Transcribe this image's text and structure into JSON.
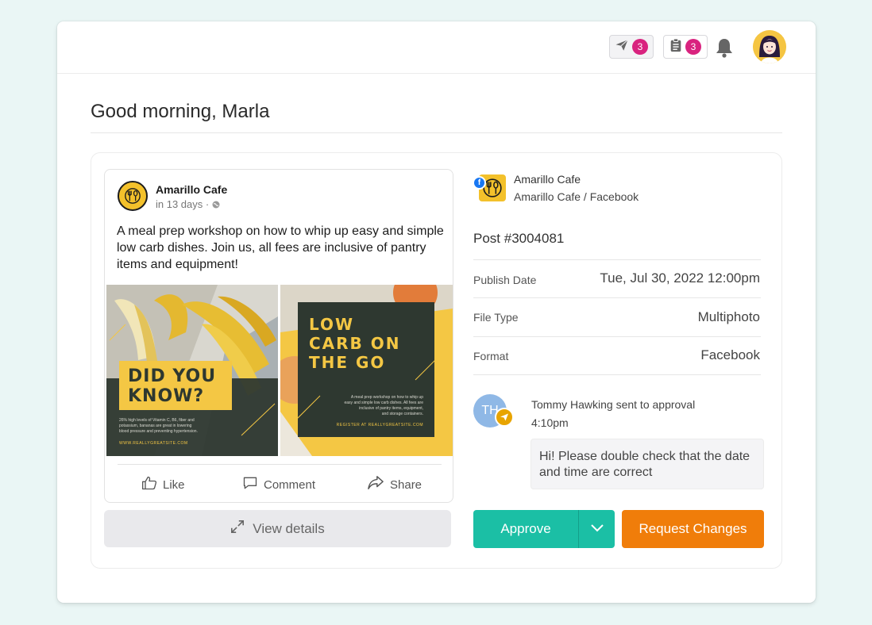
{
  "header": {
    "sent_count": "3",
    "tasks_count": "3",
    "icons": [
      "paper-plane-icon",
      "clipboard-icon",
      "bell-icon",
      "user-avatar"
    ]
  },
  "greeting": "Good morning, Marla",
  "post_preview": {
    "page_name": "Amarillo Cafe",
    "schedule": "in 13 days ·",
    "text": "A meal prep workshop on how to whip up easy and simple low carb dishes. Join us, all fees are inclusive of pantry items and equipment!",
    "image1": {
      "headline_line1": "DID YOU",
      "headline_line2": "KNOW?",
      "body_line1": "26% high levels of Vitamin C, B6, fiber and",
      "body_line2": "potassium, bananas are great in lowering",
      "body_line3": "blood pressure and preventing hypertension.",
      "site": "WWW.REALLYGREATSITE.COM"
    },
    "image2": {
      "headline_line1": "LOW",
      "headline_line2": "CARB ON",
      "headline_line3": "THE GO",
      "body_line1": "A meal prep workshop on how to whip up",
      "body_line2": "easy and simple low carb dishes. All fees are",
      "body_line3": "inclusive of pantry items, equipment,",
      "body_line4": "and storage containers.",
      "site": "REGISTER AT REALLYGREATSITE.COM"
    },
    "actions": {
      "like": "Like",
      "comment": "Comment",
      "share": "Share"
    }
  },
  "view_details_label": "View details",
  "details": {
    "account_name": "Amarillo Cafe",
    "account_path": "Amarillo Cafe / Facebook",
    "network_badge": "f",
    "post_id": "Post #3004081",
    "rows": [
      {
        "label": "Publish Date",
        "value": "Tue, Jul 30, 2022 12:00pm"
      },
      {
        "label": "File Type",
        "value": "Multiphoto"
      },
      {
        "label": "Format",
        "value": "Facebook"
      }
    ]
  },
  "approval": {
    "initials": "TH",
    "title": "Tommy Hawking sent to approval",
    "time": "4:10pm",
    "message": "Hi! Please double check that the date and time are correct"
  },
  "buttons": {
    "approve": "Approve",
    "request_changes": "Request Changes"
  },
  "colors": {
    "approve": "#1bbfa5",
    "request": "#f07d0a",
    "badge": "#d9237f",
    "brand_yellow": "#f3c12b"
  }
}
